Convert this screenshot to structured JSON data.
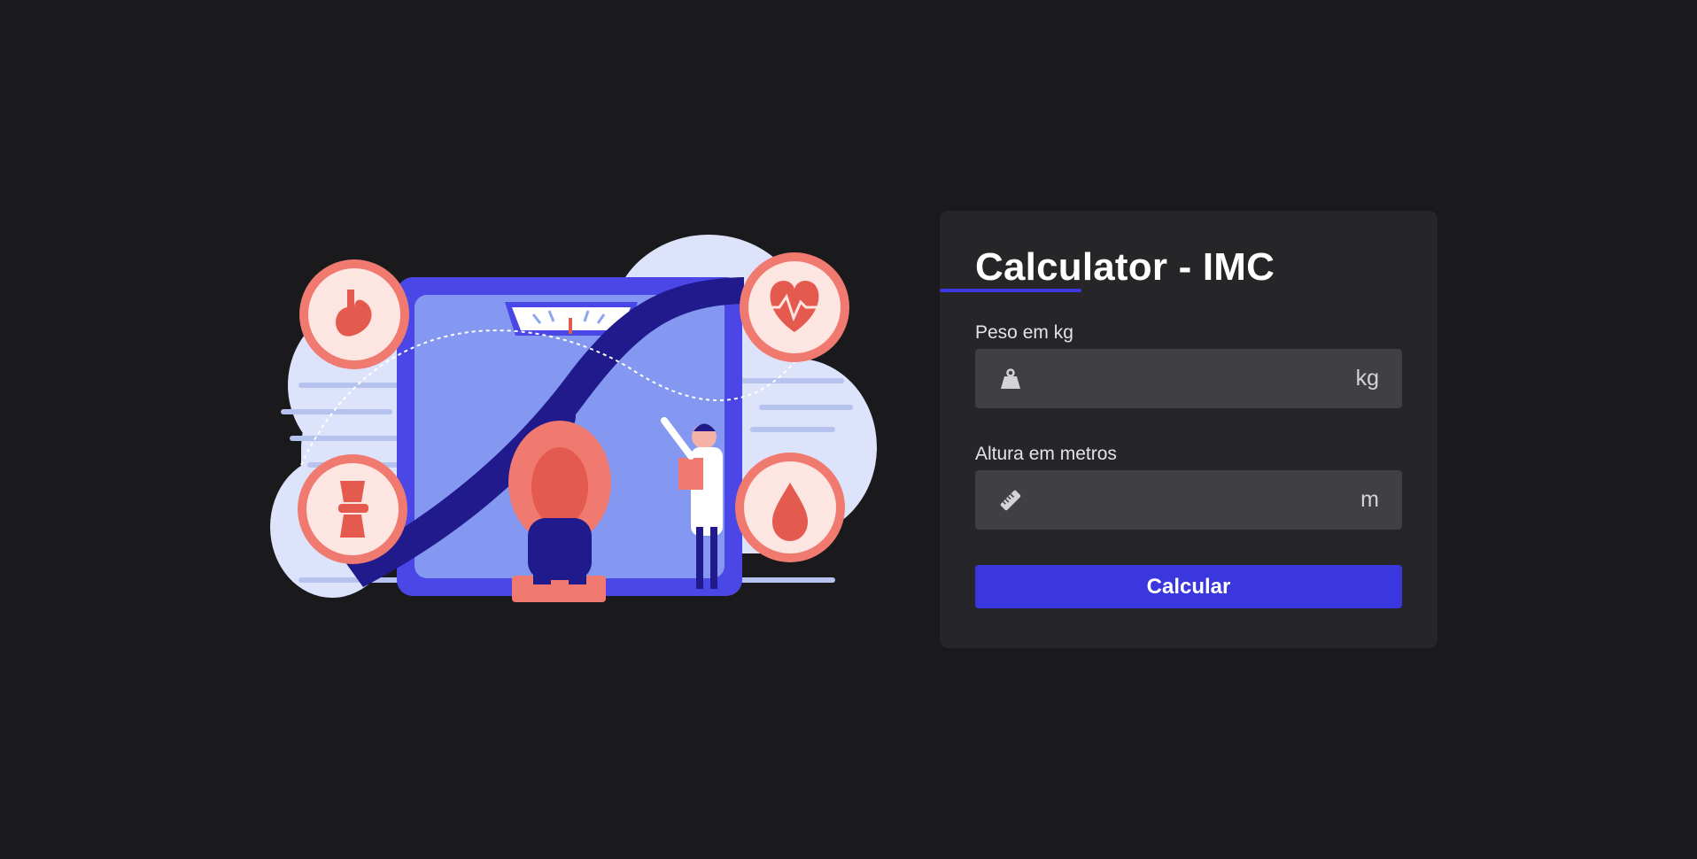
{
  "form": {
    "title": "Calculator - IMC",
    "weight": {
      "label": "Peso em kg",
      "value": "",
      "placeholder": "",
      "unit": "kg",
      "icon": "weight-icon"
    },
    "height": {
      "label": "Altura em metros",
      "value": "",
      "placeholder": "",
      "unit": "m",
      "icon": "ruler-icon"
    },
    "submit_label": "Calcular"
  },
  "colors": {
    "background": "#1a1a1c",
    "card": "#262628",
    "input": "#3f3f44",
    "accent": "#3b37de",
    "illustration_coral": "#f07a6f",
    "illustration_blue": "#4b47e6"
  },
  "illustration": {
    "description_icons": [
      "stomach-icon",
      "heart-rate-icon",
      "joint-icon",
      "blood-drop-icon"
    ]
  }
}
